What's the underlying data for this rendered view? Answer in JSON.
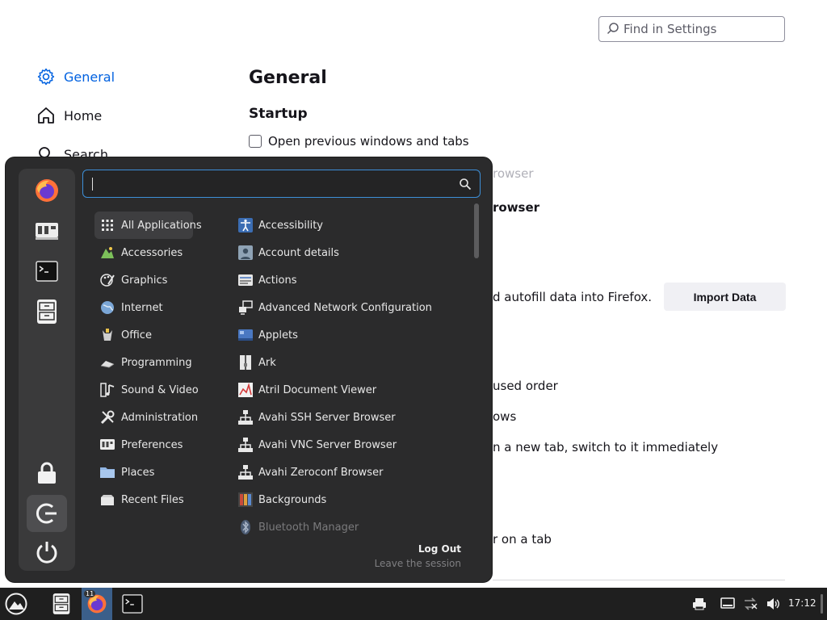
{
  "settings": {
    "search_placeholder": "Find in Settings",
    "sidebar": [
      {
        "label": "General"
      },
      {
        "label": "Home"
      },
      {
        "label": "Search"
      }
    ],
    "page_title": "General",
    "startup_heading": "Startup",
    "open_previous_label": "Open previous windows and tabs",
    "partial_texts": {
      "default_browser_faded": "rowser",
      "default_browser_bold": "rowser",
      "import_desc": "d autofill data into Firefox.",
      "ctrl_tab": "used order",
      "open_links": "ows",
      "switch_tab": "n a new tab, switch to it immediately",
      "hover_tab": "r on a tab"
    },
    "import_button": "Import Data"
  },
  "app_menu": {
    "search_value": "",
    "categories": [
      {
        "label": "All Applications",
        "icon": "grid-icon"
      },
      {
        "label": "Accessories",
        "icon": "accessories-icon"
      },
      {
        "label": "Graphics",
        "icon": "graphics-icon"
      },
      {
        "label": "Internet",
        "icon": "globe-icon"
      },
      {
        "label": "Office",
        "icon": "office-icon"
      },
      {
        "label": "Programming",
        "icon": "programming-icon"
      },
      {
        "label": "Sound & Video",
        "icon": "multimedia-icon"
      },
      {
        "label": "Administration",
        "icon": "tools-icon"
      },
      {
        "label": "Preferences",
        "icon": "preferences-icon"
      },
      {
        "label": "Places",
        "icon": "folder-icon"
      },
      {
        "label": "Recent Files",
        "icon": "recent-icon"
      }
    ],
    "apps": [
      {
        "label": "Accessibility",
        "icon": "accessibility-icon"
      },
      {
        "label": "Account details",
        "icon": "user-icon"
      },
      {
        "label": "Actions",
        "icon": "actions-icon"
      },
      {
        "label": "Advanced Network Configuration",
        "icon": "network-icon"
      },
      {
        "label": "Applets",
        "icon": "applets-icon"
      },
      {
        "label": "Ark",
        "icon": "archive-icon"
      },
      {
        "label": "Atril Document Viewer",
        "icon": "document-viewer-icon"
      },
      {
        "label": "Avahi SSH Server Browser",
        "icon": "network-tree-icon"
      },
      {
        "label": "Avahi VNC Server Browser",
        "icon": "network-tree-icon"
      },
      {
        "label": "Avahi Zeroconf Browser",
        "icon": "network-tree-icon"
      },
      {
        "label": "Backgrounds",
        "icon": "backgrounds-icon"
      },
      {
        "label": "Bluetooth Manager",
        "icon": "bluetooth-icon"
      }
    ],
    "logout_title": "Log Out",
    "logout_subtitle": "Leave the session"
  },
  "taskbar": {
    "firefox_badge": "11",
    "clock": "17:12"
  }
}
